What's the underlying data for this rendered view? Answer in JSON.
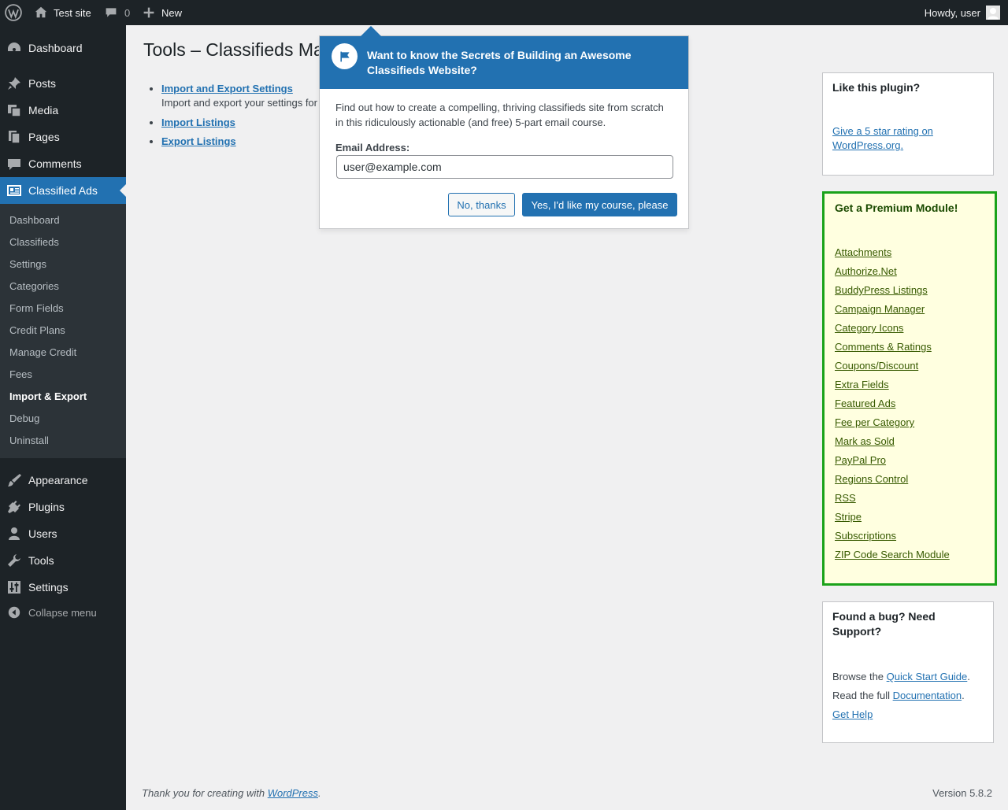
{
  "adminbar": {
    "site_name": "Test site",
    "comments_count": "0",
    "new_label": "New",
    "howdy": "Howdy, user"
  },
  "sidebar": {
    "menu": [
      {
        "label": "Dashboard",
        "icon": "dashboard-icon"
      },
      {
        "label": "Posts",
        "icon": "pushpin-icon"
      },
      {
        "label": "Media",
        "icon": "media-icon"
      },
      {
        "label": "Pages",
        "icon": "pages-icon"
      },
      {
        "label": "Comments",
        "icon": "comment-icon"
      },
      {
        "label": "Classified Ads",
        "icon": "classified-icon"
      }
    ],
    "submenu": [
      "Dashboard",
      "Classifieds",
      "Settings",
      "Categories",
      "Form Fields",
      "Credit Plans",
      "Manage Credit",
      "Fees",
      "Import & Export",
      "Debug",
      "Uninstall"
    ],
    "current_submenu": "Import & Export",
    "menu_bottom": [
      {
        "label": "Appearance",
        "icon": "brush-icon"
      },
      {
        "label": "Plugins",
        "icon": "plugin-icon"
      },
      {
        "label": "Users",
        "icon": "user-icon"
      },
      {
        "label": "Tools",
        "icon": "wrench-icon"
      },
      {
        "label": "Settings",
        "icon": "settings-icon"
      }
    ],
    "collapse_label": "Collapse menu"
  },
  "main": {
    "title": "Tools – Classifieds Ma",
    "tools": [
      {
        "link": "Import and Export Settings",
        "desc": "Import and export your settings for"
      },
      {
        "link": "Import Listings",
        "desc": ""
      },
      {
        "link": "Export Listings",
        "desc": ""
      }
    ]
  },
  "pointer": {
    "title": "Want to know the Secrets of Building an Awesome Classifieds Website?",
    "body": "Find out how to create a compelling, thriving classifieds site from scratch in this ridiculously actionable (and free) 5-part email course.",
    "email_label": "Email Address:",
    "email_value": "user@example.com",
    "no_button": "No, thanks",
    "yes_button": "Yes, I'd like my course, please"
  },
  "rightbar": {
    "like": {
      "title": "Like this plugin?",
      "link": "Give a 5 star rating on WordPress.org."
    },
    "premium": {
      "title": "Get a Premium Module!",
      "modules": [
        "Attachments",
        "Authorize.Net",
        "BuddyPress Listings",
        "Campaign Manager",
        "Category Icons",
        "Comments & Ratings",
        "Coupons/Discount",
        "Extra Fields",
        "Featured Ads",
        "Fee per Category",
        "Mark as Sold",
        "PayPal Pro",
        "Regions Control",
        "RSS",
        "Stripe",
        "Subscriptions",
        "ZIP Code Search Module"
      ]
    },
    "support": {
      "title": "Found a bug? Need Support?",
      "browse_text": "Browse the",
      "browse_link": "Quick Start Guide",
      "read_text": "Read the full",
      "read_link": "Documentation",
      "help_link": "Get Help"
    }
  },
  "footer": {
    "thanks_text": "Thank you for creating with",
    "wp_link": "WordPress",
    "version": "Version 5.8.2"
  },
  "colors": {
    "adminbar_bg": "#1d2327",
    "accent": "#2271b1",
    "premium_bg": "#ffffe0",
    "premium_border": "#1aa21a"
  }
}
